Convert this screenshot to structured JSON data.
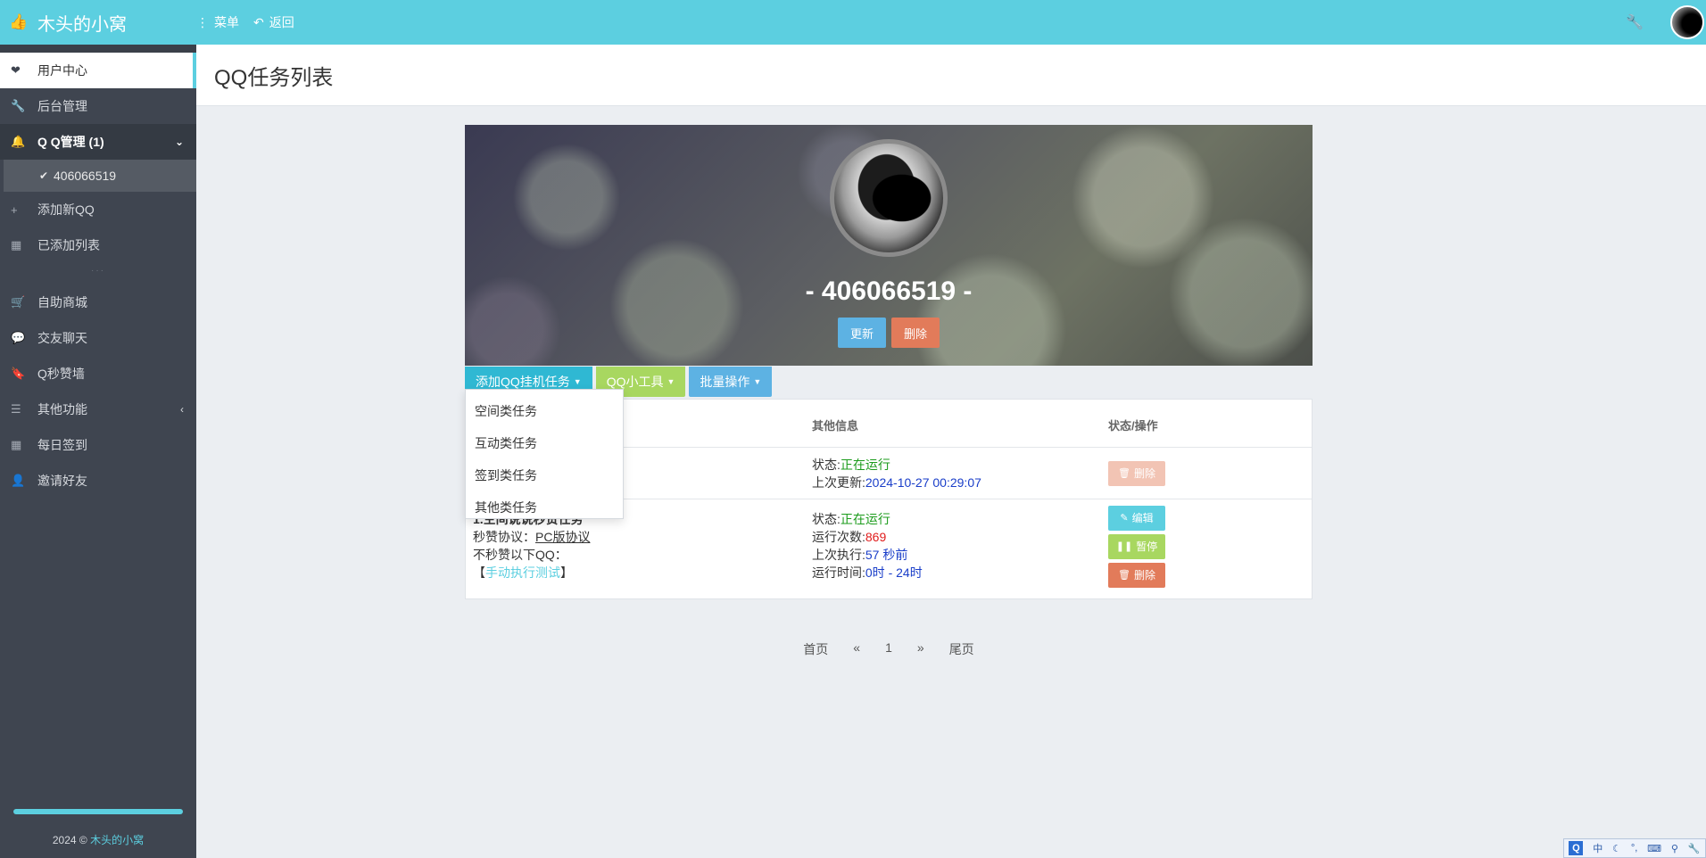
{
  "topbar": {
    "brand": "木头的小窝",
    "menu_label": "菜单",
    "back_label": "返回"
  },
  "sidebar": {
    "items": [
      {
        "label": "用户中心"
      },
      {
        "label": "后台管理"
      },
      {
        "label": "Q Q管理 (1)"
      },
      {
        "label": "添加新QQ"
      },
      {
        "label": "已添加列表"
      },
      {
        "label": "自助商城"
      },
      {
        "label": "交友聊天"
      },
      {
        "label": "Q秒赞墙"
      },
      {
        "label": "其他功能"
      },
      {
        "label": "每日签到"
      },
      {
        "label": "邀请好友"
      }
    ],
    "sub_item": "406066519",
    "footer_year": "2024 ©",
    "footer_link": "木头的小窝"
  },
  "page": {
    "title": "QQ任务列表"
  },
  "banner": {
    "qq_number": "- 406066519 -",
    "update_label": "更新",
    "delete_label": "删除"
  },
  "actions": {
    "add_task": "添加QQ挂机任务",
    "tools": "QQ小工具",
    "batch": "批量操作"
  },
  "dropdown": {
    "items": [
      "空间类任务",
      "互动类任务",
      "签到类任务",
      "其他类任务"
    ]
  },
  "table": {
    "headers": [
      "其他信息",
      "状态/操作"
    ],
    "row1": {
      "status_label": "状态:",
      "status_value": "正在运行",
      "updated_label": "上次更新:",
      "updated_value": "2024-10-27 00:29:07",
      "delete_label": "删除"
    },
    "row2": {
      "name": "1.空间说说秒赞任务",
      "protocol_label": "秒赞协议：",
      "protocol_value": "PC版协议",
      "exclude_label": "不秒赞以下QQ：",
      "manual_open": "【",
      "manual_link": "手动执行测试",
      "manual_close": "】",
      "status_label": "状态:",
      "status_value": "正在运行",
      "runs_label": "运行次数:",
      "runs_value": "869",
      "last_label": "上次执行:",
      "last_value": "57 秒前",
      "time_label": "运行时间:",
      "time_value": "0时 - 24时",
      "edit_label": "编辑",
      "pause_label": "暂停",
      "delete_label": "删除"
    }
  },
  "pager": {
    "first": "首页",
    "prev": "«",
    "page": "1",
    "next": "»",
    "last": "尾页"
  },
  "ime": {
    "q": "Q",
    "lang": "中"
  },
  "colors": {
    "accent": "#5ccfe0",
    "sidebar_bg": "#3f4550",
    "running": "#1b9b1b"
  }
}
